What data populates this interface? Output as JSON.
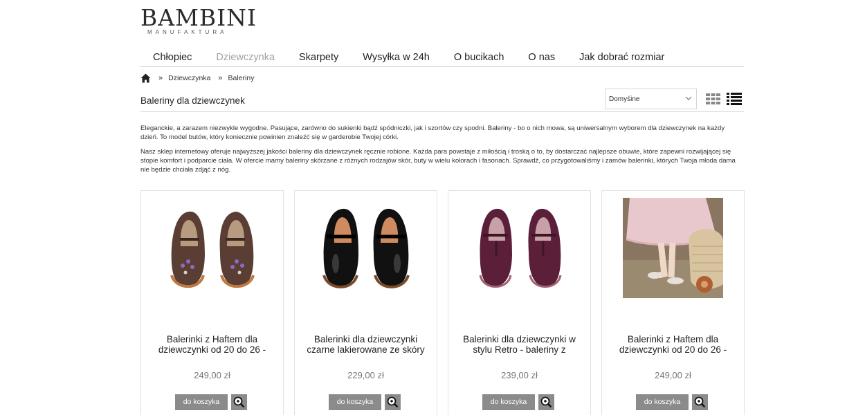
{
  "logo": {
    "main": "BAMBINI",
    "sub": "MANUFAKTURA"
  },
  "nav": [
    {
      "label": "Chłopiec",
      "active": false
    },
    {
      "label": "Dziewczynka",
      "active": true
    },
    {
      "label": "Skarpety",
      "active": false
    },
    {
      "label": "Wysyłka w 24h",
      "active": false
    },
    {
      "label": "O bucikach",
      "active": false
    },
    {
      "label": "O nas",
      "active": false
    },
    {
      "label": "Jak dobrać rozmiar",
      "active": false
    }
  ],
  "breadcrumb": {
    "sep": "»",
    "items": [
      "Dziewczynka",
      "Baleriny"
    ]
  },
  "page": {
    "title": "Baleriny dla dziewczynek",
    "sort_value": "Domyśine"
  },
  "description": [
    "Eleganckie, a zarazem niezwykle wygodne. Pasujące, zarówno do sukienki bądź spódniczki, jak i szortów czy spodni. Baleriny - bo o nich mowa, są uniwersalnym wyborem dla dziewczynek na każdy dzień. To model butów, który koniecznie powinien znaleźć się w garderobie Twojej córki.",
    "Nasz sklep internetowy oferuje najwyższej jakości baleriny dla dziewczynek ręcznie robione. Każda para powstaje z miłością i troską o to, by dostarczać najlepsze obuwie, które zapewni rozwijającej się stopie komfort i podparcie ciała. W ofercie mamy baleriny skórzane z różnych rodzajów skór, buty w wielu kolorach i fasonach. Sprawdź, co przygotowaliśmy i zamów balerinki, których Twoja młoda dama nie będzie chciała zdjąć z nóg."
  ],
  "products": [
    {
      "name_line1": "Balerinki z Haftem dla",
      "name_line2": "dziewczynki od 20 do 26 -",
      "price": "249,00 zł",
      "cart_label": "do koszyka",
      "shoe_color": "#5a3e33"
    },
    {
      "name_line1": "Balerinki dla dziewczynki",
      "name_line2": "czarne lakierowane ze skóry",
      "price": "229,00 zł",
      "cart_label": "do koszyka",
      "shoe_color": "#111111"
    },
    {
      "name_line1": "Balerinki dla dziewczynki w",
      "name_line2": "stylu Retro - baleriny z",
      "price": "239,00 zł",
      "cart_label": "do koszyka",
      "shoe_color": "#5b1f3a"
    },
    {
      "name_line1": "Balerinki z Haftem dla",
      "name_line2": "dziewczynki od 20 do 26 -",
      "price": "249,00 zł",
      "cart_label": "do koszyka",
      "shoe_color": "#c9b8a8"
    }
  ]
}
